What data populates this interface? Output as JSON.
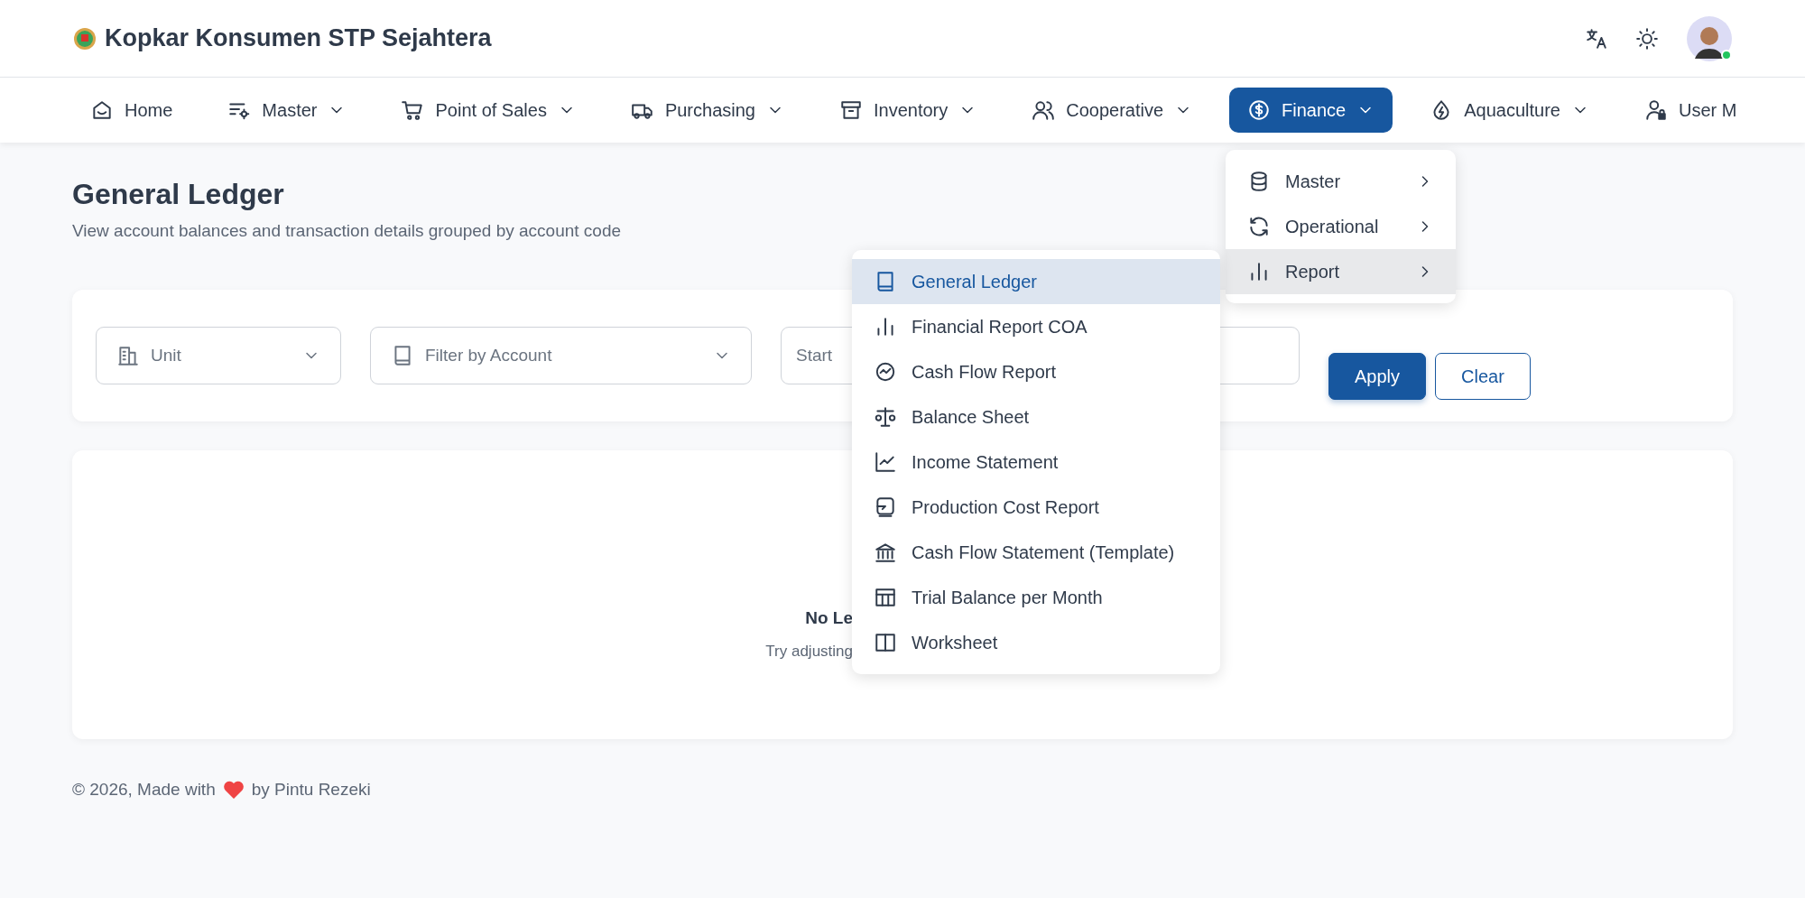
{
  "app": {
    "title": "Kopkar Konsumen STP Sejahtera",
    "user_online": true
  },
  "nav": [
    {
      "label": "Home",
      "has_menu": false,
      "selected": false
    },
    {
      "label": "Master",
      "has_menu": true,
      "selected": false
    },
    {
      "label": "Point of Sales",
      "has_menu": true,
      "selected": false
    },
    {
      "label": "Purchasing",
      "has_menu": true,
      "selected": false
    },
    {
      "label": "Inventory",
      "has_menu": true,
      "selected": false
    },
    {
      "label": "Cooperative",
      "has_menu": true,
      "selected": false
    },
    {
      "label": "Finance",
      "has_menu": true,
      "selected": true
    },
    {
      "label": "Aquaculture",
      "has_menu": true,
      "selected": false
    },
    {
      "label": "User M",
      "has_menu": false,
      "selected": false
    }
  ],
  "finance_menu": [
    {
      "label": "Master",
      "selected": false
    },
    {
      "label": "Operational",
      "selected": false
    },
    {
      "label": "Report",
      "selected": true
    }
  ],
  "report_menu": [
    {
      "label": "General Ledger",
      "selected": true
    },
    {
      "label": "Financial Report COA",
      "selected": false
    },
    {
      "label": "Cash Flow Report",
      "selected": false
    },
    {
      "label": "Balance Sheet",
      "selected": false
    },
    {
      "label": "Income Statement",
      "selected": false
    },
    {
      "label": "Production Cost Report",
      "selected": false
    },
    {
      "label": "Cash Flow Statement (Template)",
      "selected": false
    },
    {
      "label": "Trial Balance per Month",
      "selected": false
    },
    {
      "label": "Worksheet",
      "selected": false
    }
  ],
  "page": {
    "title": "General Ledger",
    "subtitle": "View account balances and transaction details grouped by account code"
  },
  "filters": {
    "unit": {
      "placeholder": "Unit"
    },
    "account": {
      "placeholder": "Filter by Account"
    },
    "start_date": {
      "placeholder": "Start"
    }
  },
  "buttons": [
    {
      "label": "Apply",
      "kind": "primary"
    },
    {
      "label": "Clear",
      "kind": "outline"
    }
  ],
  "empty_state": {
    "title": "No Le",
    "message": "Try adjusting"
  },
  "footer": {
    "before": "© 2026, Made with",
    "after": "by Pintu Rezeki"
  }
}
